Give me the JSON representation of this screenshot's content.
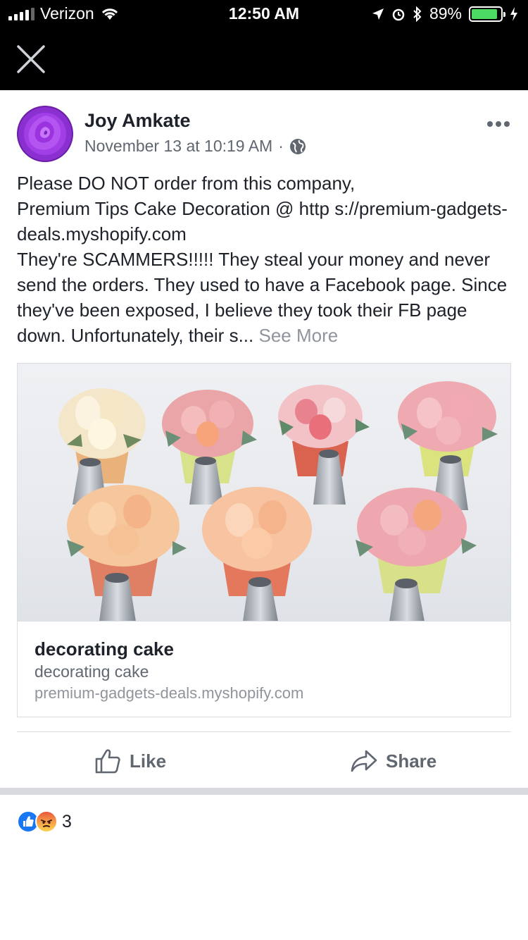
{
  "status_bar": {
    "carrier": "Verizon",
    "time": "12:50 AM",
    "battery_percent": "89%",
    "battery_level": 0.89,
    "battery_color": "#4cd964"
  },
  "nav": {
    "close_icon": "close-icon"
  },
  "post": {
    "author": "Joy Amkate",
    "timestamp": "November 13 at 10:19 AM",
    "separator": "·",
    "privacy_icon": "globe-icon",
    "text": "Please DO NOT order from this company,\nPremium Tips Cake Decoration @ http s://premium-gadgets-deals.myshopify.com\nThey're SCAMMERS!!!!! They steal your money and never send the orders. They used to have a Facebook page. Since they've been exposed, I believe they took their FB page down. Unfortunately, their s...",
    "see_more": "See More"
  },
  "link_card": {
    "title": "decorating cake",
    "description": "decorating cake",
    "domain": "premium-gadgets-deals.myshopify.com"
  },
  "actions": {
    "like_label": "Like",
    "share_label": "Share"
  },
  "reactions": {
    "icons": [
      "like-reaction-icon",
      "angry-reaction-icon"
    ],
    "count": "3"
  },
  "colors": {
    "facebook_blue": "#1877f2",
    "secondary_text": "#606770",
    "see_more": "#90949c"
  }
}
